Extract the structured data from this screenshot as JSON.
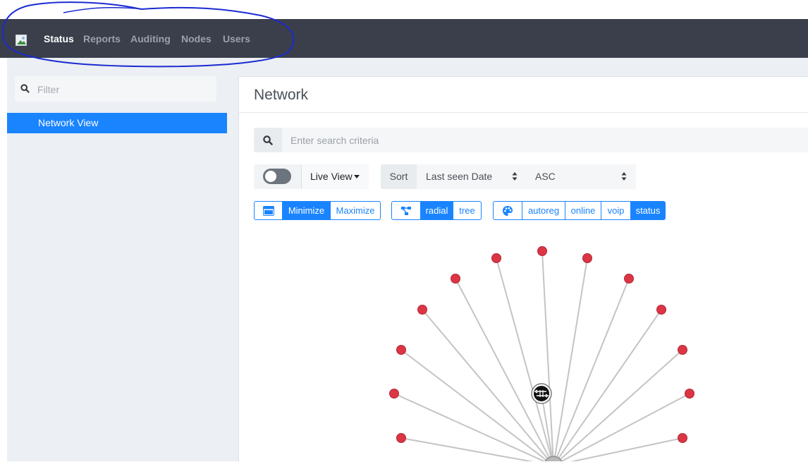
{
  "nav": {
    "items": [
      {
        "label": "Status",
        "active": true
      },
      {
        "label": "Reports",
        "active": false
      },
      {
        "label": "Auditing",
        "active": false
      },
      {
        "label": "Nodes",
        "active": false
      },
      {
        "label": "Users",
        "active": false
      }
    ]
  },
  "sidebar": {
    "filter_placeholder": "Filter",
    "items": [
      {
        "label": "Network View",
        "active": true
      }
    ]
  },
  "main": {
    "title": "Network",
    "search_placeholder": "Enter search criteria",
    "live_view_label": "Live View",
    "live_view_enabled": false,
    "sort": {
      "label": "Sort",
      "field": "Last seen Date",
      "order": "ASC"
    },
    "size_buttons": {
      "minimize": "Minimize",
      "maximize": "Maximize",
      "selected": "Minimize"
    },
    "layout_buttons": {
      "radial": "radial",
      "tree": "tree",
      "selected": "radial"
    },
    "color_buttons": {
      "autoreg": "autoreg",
      "online": "online",
      "voip": "voip",
      "status": "status",
      "selected": "status"
    }
  },
  "colors": {
    "accent": "#1a84ff",
    "navbar": "#3a3f4b",
    "node_offline": "#dc3545",
    "edge": "#c4c4c4",
    "annotation_ink": "#1a2bd1"
  },
  "icons": {
    "filter": "search-icon",
    "search": "search-icon",
    "size": "window-icon",
    "layout": "network-tree-icon",
    "color": "palette-icon",
    "center_node": "router-icon"
  }
}
